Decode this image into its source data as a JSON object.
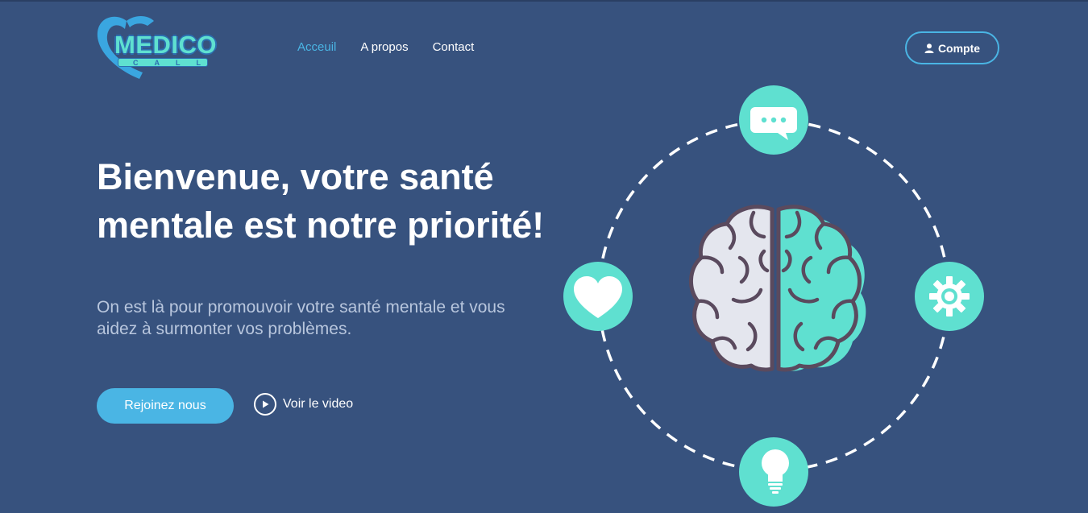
{
  "logo": {
    "word": "MEDICO",
    "sub": "CALL"
  },
  "nav": {
    "items": [
      {
        "label": "Acceuil",
        "active": true
      },
      {
        "label": "A propos",
        "active": false
      },
      {
        "label": "Contact",
        "active": false
      }
    ]
  },
  "account": {
    "label": "Compte",
    "icon": "user-icon"
  },
  "hero": {
    "title": "Bienvenue, votre santé mentale est notre priorité!",
    "subtitle": "On est là pour promouvoir votre santé mentale et vous aidez à surmonter vos problèmes.",
    "join_label": "Rejoinez nous",
    "video_label": "Voir le video"
  },
  "illustration": {
    "orbit_icons": [
      "chat-bubble-icon",
      "gear-icon",
      "lightbulb-icon",
      "heart-icon"
    ],
    "center_icon": "brain-icon"
  },
  "colors": {
    "background": "#37527e",
    "accent_blue": "#4ab5e4",
    "accent_teal": "#5fe0d0",
    "text_muted": "#b8c6dd"
  }
}
